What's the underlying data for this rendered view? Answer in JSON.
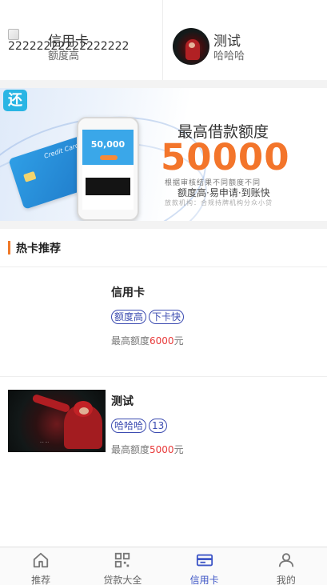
{
  "top_cards": [
    {
      "image_alt": "2222222222222222222",
      "title": "信用卡",
      "subtitle": "额度高",
      "image_icon": "broken-image-icon"
    },
    {
      "title": "测试",
      "subtitle": "哈哈哈",
      "image_icon": "avatar-photo"
    }
  ],
  "banner": {
    "badge": "还",
    "headline": "最高借款额度",
    "amount": "50000",
    "line1": "根据审核结果不同额度不同",
    "line2": "额度高·易申请·到账快",
    "line3": "放款机构：合规持牌机构分众小贷",
    "phone_amount": "50,000",
    "card_text": "Credit Card"
  },
  "section": {
    "title": "热卡推荐",
    "accent_color": "#f07a2a"
  },
  "cards": [
    {
      "title": "信用卡",
      "tags": [
        "额度高",
        "下卡快"
      ],
      "quota_prefix": "最高额度",
      "quota_amount": "6000",
      "quota_unit": "元",
      "has_image": false
    },
    {
      "title": "测试",
      "tags": [
        "哈哈哈",
        "13"
      ],
      "quota_prefix": "最高额度",
      "quota_amount": "5000",
      "quota_unit": "元",
      "has_image": true
    }
  ],
  "bottom_nav": [
    {
      "label": "推荐",
      "icon": "home-icon",
      "active": false
    },
    {
      "label": "贷款大全",
      "icon": "grid-icon",
      "active": false
    },
    {
      "label": "信用卡",
      "icon": "credit-card-icon",
      "active": true
    },
    {
      "label": "我的",
      "icon": "user-icon",
      "active": false
    }
  ],
  "colors": {
    "active": "#3d55c6",
    "tag_border": "#3b4bb0",
    "amount_red": "#e83a3a",
    "banner_orange": "#f3752b"
  }
}
